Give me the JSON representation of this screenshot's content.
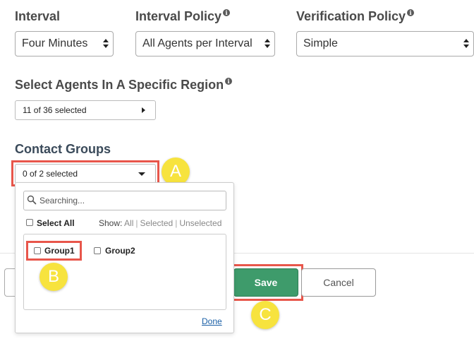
{
  "fields": {
    "interval": {
      "label": "Interval",
      "value": "Four Minutes"
    },
    "interval_policy": {
      "label": "Interval Policy",
      "value": "All Agents per Interval"
    },
    "verification_policy": {
      "label": "Verification Policy",
      "value": "Simple"
    }
  },
  "agents_region": {
    "label": "Select Agents In A Specific Region",
    "value": "11 of 36 selected"
  },
  "contact_groups": {
    "label": "Contact Groups",
    "value": "0 of 2 selected",
    "dropdown": {
      "search_placeholder": "Searching...",
      "select_all": "Select All",
      "show_label": "Show:",
      "show_all": "All",
      "show_selected": "Selected",
      "show_unselected": "Unselected",
      "groups": [
        "Group1",
        "Group2"
      ],
      "done": "Done"
    }
  },
  "buttons": {
    "save": "Save",
    "cancel": "Cancel"
  },
  "markers": {
    "a": "A",
    "b": "B",
    "c": "C"
  },
  "colors": {
    "highlight": "#e8564b",
    "marker": "#f7e33e",
    "save": "#3e9b6b",
    "link": "#1a5fa6"
  },
  "icons": {
    "info": "info-icon",
    "search": "search-icon"
  }
}
